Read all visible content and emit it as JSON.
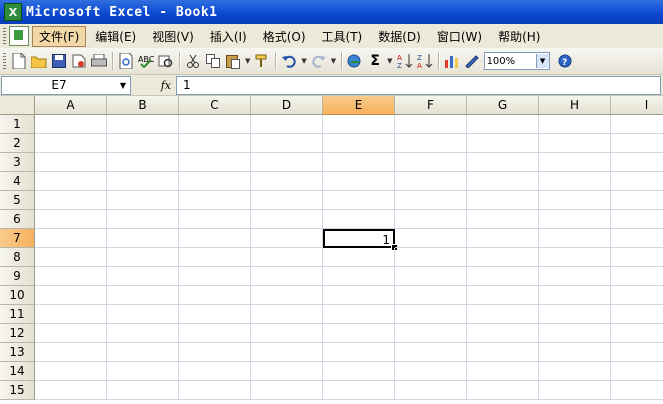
{
  "window": {
    "title": "Microsoft Excel - Book1",
    "app_icon": "excel-app-icon"
  },
  "menu": {
    "items": [
      {
        "label": "文件(F)",
        "active": true
      },
      {
        "label": "编辑(E)"
      },
      {
        "label": "视图(V)"
      },
      {
        "label": "插入(I)"
      },
      {
        "label": "格式(O)"
      },
      {
        "label": "工具(T)"
      },
      {
        "label": "数据(D)"
      },
      {
        "label": "窗口(W)"
      },
      {
        "label": "帮助(H)"
      }
    ]
  },
  "toolbar": {
    "zoom": "100%",
    "icons": [
      "new-icon",
      "open-icon",
      "save-icon",
      "permission-icon",
      "print-icon",
      "print-preview-icon",
      "spelling-icon",
      "research-icon",
      "cut-icon",
      "copy-icon",
      "paste-icon",
      "format-painter-icon",
      "undo-icon",
      "redo-icon",
      "hyperlink-icon",
      "autosum-icon",
      "sort-ascending-icon",
      "sort-descending-icon",
      "chart-wizard-icon",
      "drawing-icon",
      "help-icon"
    ]
  },
  "formula_bar": {
    "name_box": "E7",
    "fx_label": "fx",
    "value": "1"
  },
  "sheet": {
    "columns": [
      "A",
      "B",
      "C",
      "D",
      "E",
      "F",
      "G",
      "H",
      "I"
    ],
    "rows": [
      "1",
      "2",
      "3",
      "4",
      "5",
      "6",
      "7",
      "8",
      "9",
      "10",
      "11",
      "12",
      "13",
      "14",
      "15"
    ],
    "active_cell": "E7",
    "active_value": "1",
    "selected_col": "E",
    "selected_row": "7"
  },
  "colors": {
    "title_bar": "#0a47cf",
    "header_selected": "#f6b15d",
    "grid_line": "#d0d7e5"
  }
}
